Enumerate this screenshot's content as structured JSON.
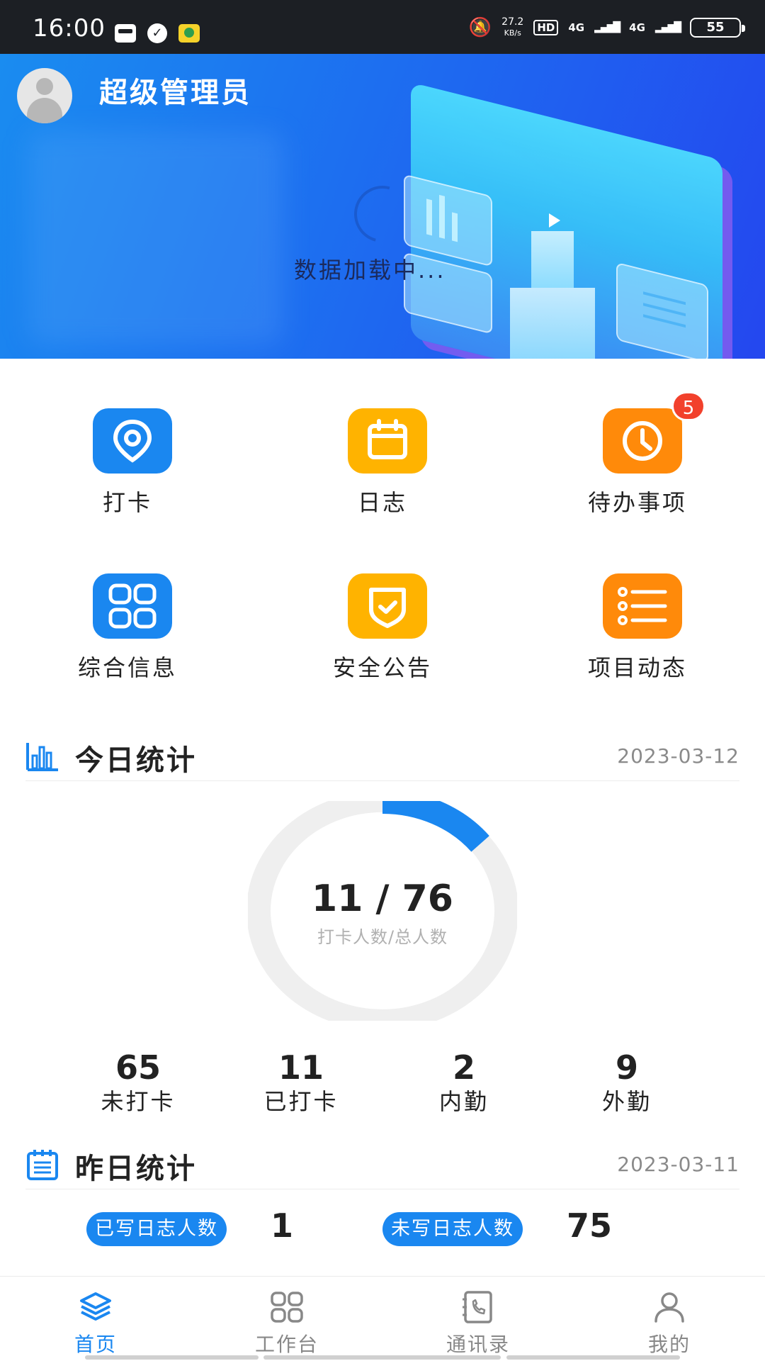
{
  "status_bar": {
    "time": "16:00",
    "speed_top": "27.2",
    "speed_unit": "KB/s",
    "hd": "HD",
    "net1": "4G",
    "net2": "4G",
    "battery": "55",
    "icons": [
      "message-box-icon",
      "check-circle-icon",
      "app-icon",
      "mute-icon",
      "signal-icon"
    ]
  },
  "header": {
    "user_name": "超级管理员",
    "loading_text": "数据加载中..."
  },
  "menu": [
    {
      "label": "打卡",
      "color": "#1a87f0",
      "icon": "location-pin-icon"
    },
    {
      "label": "日志",
      "color": "#ffb300",
      "icon": "calendar-icon"
    },
    {
      "label": "待办事项",
      "color": "#ff8a0a",
      "icon": "clock-icon",
      "badge": "5"
    },
    {
      "label": "综合信息",
      "color": "#1a87f0",
      "icon": "grid-icon"
    },
    {
      "label": "安全公告",
      "color": "#ffb300",
      "icon": "shield-check-icon"
    },
    {
      "label": "项目动态",
      "color": "#ff8a0a",
      "icon": "list-icon"
    }
  ],
  "today": {
    "title": "今日统计",
    "date": "2023-03-12",
    "ratio_text": "11 / 76",
    "ratio_sub": "打卡人数/总人数",
    "checked_in": 11,
    "total": 76,
    "stats": [
      {
        "value": "65",
        "label": "未打卡"
      },
      {
        "value": "11",
        "label": "已打卡"
      },
      {
        "value": "2",
        "label": "内勤"
      },
      {
        "value": "9",
        "label": "外勤"
      }
    ]
  },
  "yesterday": {
    "title": "昨日统计",
    "date": "2023-03-11",
    "written_label": "已写日志人数",
    "written_value": "1",
    "unwritten_label": "未写日志人数",
    "unwritten_value": "75"
  },
  "tabs": [
    {
      "label": "首页",
      "icon": "home-icon",
      "active": true
    },
    {
      "label": "工作台",
      "icon": "workbench-grid-icon",
      "active": false
    },
    {
      "label": "通讯录",
      "icon": "contacts-phone-icon",
      "active": false
    },
    {
      "label": "我的",
      "icon": "profile-icon",
      "active": false
    }
  ],
  "colors": {
    "accent": "#1a87f0",
    "yellow": "#ffb300",
    "orange": "#ff8a0a",
    "badge": "#f2412c"
  }
}
